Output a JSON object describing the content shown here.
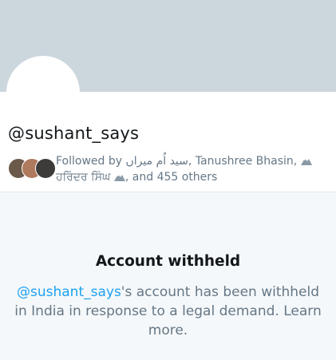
{
  "profile": {
    "handle": "@sushant_says",
    "followed_by": {
      "prefix": "Followed by ",
      "name1": "سید اُم میراں",
      "name2": "Tanushree Bhasin",
      "name3": "ਹਰਿੰਦਰ ਸਿੰਘ",
      "suffix": ", and 455 others",
      "emoji_icon": "mountain-snow-icon"
    }
  },
  "withheld": {
    "title": "Account withheld",
    "handle_link": "@sushant_says",
    "message": "'s account has been withheld in India in response to a legal demand. ",
    "learn_more": "Learn more."
  },
  "colors": {
    "banner": "#ccd6dd",
    "link": "#1da1f2",
    "muted_text": "#657786",
    "withheld_bg": "#f5f8fa"
  }
}
